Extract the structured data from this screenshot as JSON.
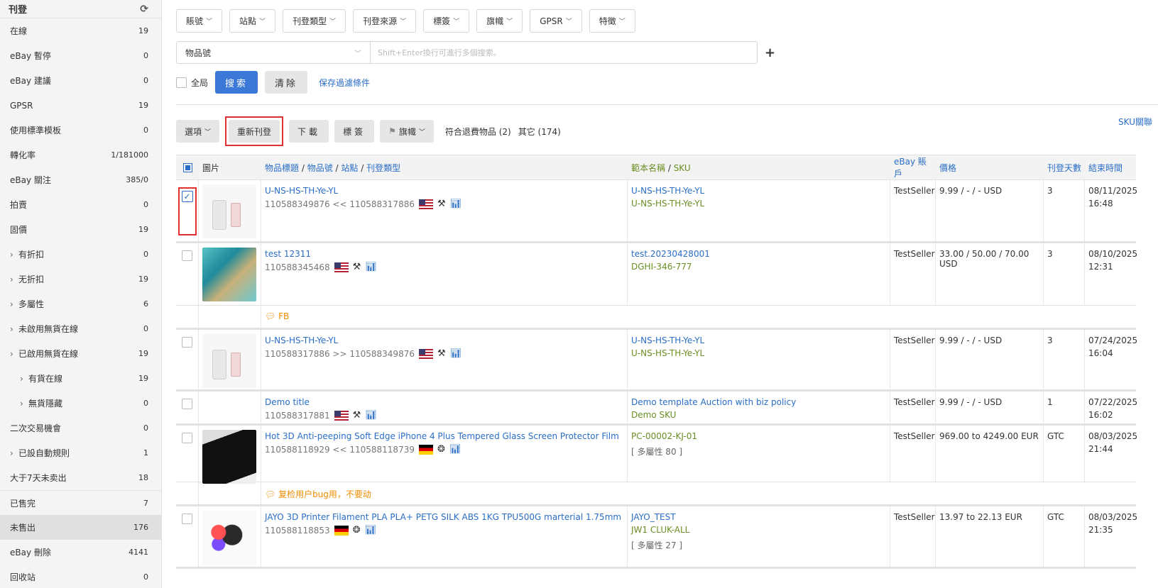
{
  "sidebar": {
    "header": "刊登",
    "items": [
      {
        "label": "在線",
        "count": "19",
        "caret": ""
      },
      {
        "label": "eBay 暫停",
        "count": "0",
        "caret": ""
      },
      {
        "label": "eBay 建議",
        "count": "0",
        "caret": ""
      },
      {
        "label": "GPSR",
        "count": "19",
        "caret": ""
      },
      {
        "label": "使用標準模板",
        "count": "0",
        "caret": ""
      },
      {
        "label": "轉化率",
        "count": "1/181000",
        "caret": ""
      },
      {
        "label": "eBay 關注",
        "count": "385/0",
        "caret": ""
      },
      {
        "label": "拍賣",
        "count": "0",
        "caret": ""
      },
      {
        "label": "固價",
        "count": "19",
        "caret": ""
      },
      {
        "label": "有折扣",
        "count": "0",
        "caret": "›"
      },
      {
        "label": "无折扣",
        "count": "19",
        "caret": "›"
      },
      {
        "label": "多屬性",
        "count": "6",
        "caret": "›"
      },
      {
        "label": "未啟用無貨在線",
        "count": "0",
        "caret": "›"
      },
      {
        "label": "已啟用無貨在線",
        "count": "19",
        "caret": "›"
      },
      {
        "label": "有貨在線",
        "count": "19",
        "caret": "›"
      },
      {
        "label": "無貨隱藏",
        "count": "0",
        "caret": "›"
      },
      {
        "label": "二次交易機會",
        "count": "0",
        "caret": ""
      },
      {
        "label": "已設自動規則",
        "count": "1",
        "caret": "›"
      },
      {
        "label": "大于7天未卖出",
        "count": "18",
        "caret": ""
      },
      {
        "label": "已售完",
        "count": "7",
        "caret": ""
      },
      {
        "label": "未售出",
        "count": "176",
        "caret": ""
      },
      {
        "label": "eBay 刪除",
        "count": "4141",
        "caret": ""
      },
      {
        "label": "回收站",
        "count": "0",
        "caret": ""
      }
    ]
  },
  "filters": [
    "賬號",
    "站點",
    "刊登類型",
    "刊登來源",
    "標簽",
    "旗幟",
    "GPSR",
    "特徵"
  ],
  "search": {
    "field": "物品號",
    "placeholder": "Shift+Enter換行可進行多個搜索。",
    "global_label": "全局",
    "search_btn": "搜索",
    "clear_btn": "清除",
    "save_filter": "保存過濾條件"
  },
  "toolbar": {
    "options": "選項",
    "relist": "重新刊登",
    "download": "下載",
    "tag": "標簽",
    "flag": "旗幟",
    "refund_text": "符合退費物品 (2)",
    "other_text": "其它 (174)",
    "sku_link": "SKU關聯"
  },
  "table": {
    "headers": {
      "image": "圖片",
      "title_parts": [
        "物品標題",
        "物品號",
        "站點",
        "刊登類型"
      ],
      "template_parts": [
        "範本名稱",
        "SKU"
      ],
      "account": "eBay 賬戶",
      "price": "價格",
      "days": "刊登天數",
      "end": "結束時間"
    },
    "rows": [
      {
        "title": "U-NS-HS-TH-Ye-YL",
        "item_no": "110588349876 << 110588317886",
        "flag": "us",
        "type_icon": "auction",
        "template": "U-NS-HS-TH-Ye-YL",
        "sku": "U-NS-HS-TH-Ye-YL",
        "variations": "",
        "account": "TestSeller",
        "price": "9.99 / - / - USD",
        "days": "3",
        "end_date": "08/11/2025",
        "end_time": "16:48",
        "checked": true,
        "thumb": "white",
        "note": ""
      },
      {
        "title": "test 12311",
        "item_no": "110588345468",
        "flag": "us",
        "type_icon": "auction",
        "template": "test.20230428001",
        "sku": "DGHI-346-777",
        "variations": "",
        "account": "TestSeller",
        "price": "33.00 / 50.00 / 70.00 USD",
        "days": "3",
        "end_date": "08/10/2025",
        "end_time": "12:31",
        "checked": false,
        "thumb": "teal",
        "note": "FB"
      },
      {
        "title": "U-NS-HS-TH-Ye-YL",
        "item_no": "110588317886 >> 110588349876",
        "flag": "us",
        "type_icon": "auction",
        "template": "U-NS-HS-TH-Ye-YL",
        "sku": "U-NS-HS-TH-Ye-YL",
        "variations": "",
        "account": "TestSeller",
        "price": "9.99 / - / - USD",
        "days": "3",
        "end_date": "07/24/2025",
        "end_time": "16:04",
        "checked": false,
        "thumb": "white",
        "note": ""
      },
      {
        "title": "Demo title",
        "item_no": "110588317881",
        "flag": "us",
        "type_icon": "auction",
        "template": "Demo template Auction with biz policy",
        "sku": "Demo SKU",
        "variations": "",
        "account": "TestSeller",
        "price": "9.99 / - / - USD",
        "days": "1",
        "end_date": "07/22/2025",
        "end_time": "16:02",
        "checked": false,
        "thumb": "",
        "note": ""
      },
      {
        "title": "Hot 3D Anti-peeping Soft Edge iPhone 4 Plus Tempered Glass Screen Protector Film",
        "item_no": "110588118929 << 110588118739",
        "flag": "de",
        "type_icon": "multi",
        "template": "",
        "sku": "PC-00002-KJ-01",
        "variations": "[ 多屬性 80 ]",
        "account": "TestSeller",
        "price": "969.00 to 4249.00 EUR",
        "days": "GTC",
        "end_date": "08/03/2025",
        "end_time": "21:44",
        "checked": false,
        "thumb": "dark",
        "note": "复检用户bug用，不要动"
      },
      {
        "title": "JAYO 3D Printer Filament PLA PLA+ PETG SILK ABS 1KG TPU500G marterial 1.75mm",
        "item_no": "110588118853",
        "flag": "de",
        "type_icon": "multi",
        "template": "JAYO_TEST",
        "sku": "JW1 CLUK-ALL",
        "variations": "[ 多屬性 27 ]",
        "account": "TestSeller",
        "price": "13.97 to 22.13 EUR",
        "days": "GTC",
        "end_date": "08/03/2025",
        "end_time": "21:35",
        "checked": false,
        "thumb": "spool",
        "note": ""
      }
    ]
  }
}
